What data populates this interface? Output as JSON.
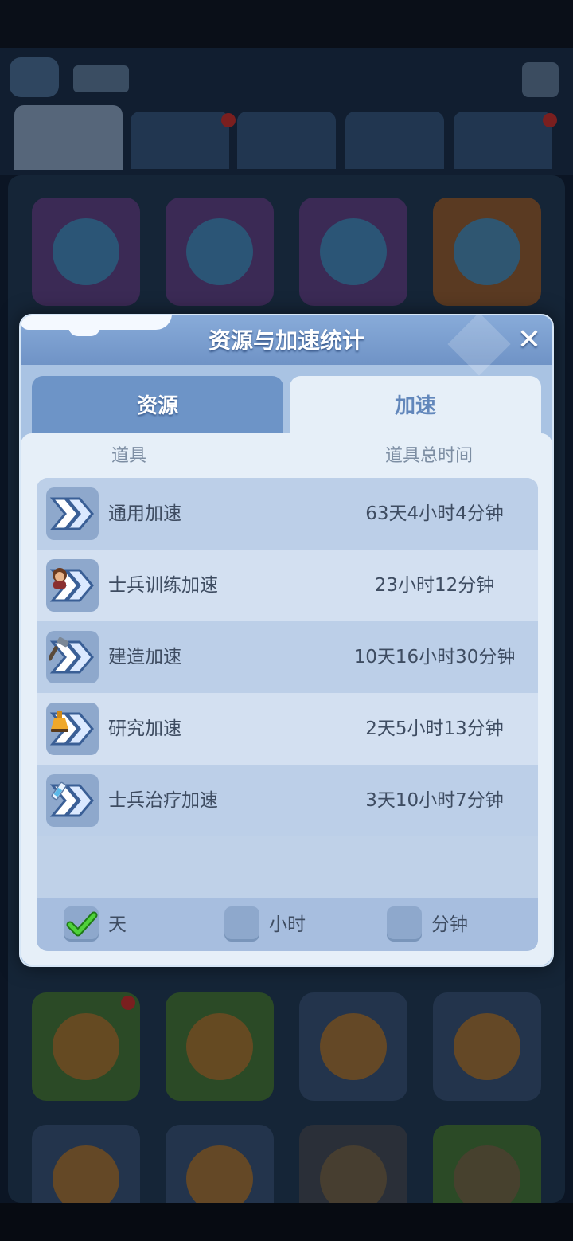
{
  "dialog": {
    "title": "资源与加速统计",
    "close_glyph": "✕",
    "tabs": [
      {
        "label": "资源",
        "active": false
      },
      {
        "label": "加速",
        "active": true
      }
    ],
    "columns": {
      "item": "道具",
      "total_time": "道具总时间"
    },
    "rows": [
      {
        "icon": "general-speedup-icon",
        "label": "通用加速",
        "time": "63天4小时4分钟"
      },
      {
        "icon": "training-speedup-icon",
        "label": "士兵训练加速",
        "time": "23小时12分钟"
      },
      {
        "icon": "building-speedup-icon",
        "label": "建造加速",
        "time": "10天16小时30分钟"
      },
      {
        "icon": "research-speedup-icon",
        "label": "研究加速",
        "time": "2天5小时13分钟"
      },
      {
        "icon": "healing-speedup-icon",
        "label": "士兵治疗加速",
        "time": "3天10小时7分钟"
      }
    ],
    "filters": [
      {
        "label": "天",
        "checked": true
      },
      {
        "label": "小时",
        "checked": false
      },
      {
        "label": "分钟",
        "checked": false
      }
    ]
  },
  "colors": {
    "header": "#7a9dce",
    "tab_active": "#e6eff8",
    "tab_inactive": "#6d94c7",
    "text": "#3e4c61",
    "check": "#3fbf2f"
  }
}
